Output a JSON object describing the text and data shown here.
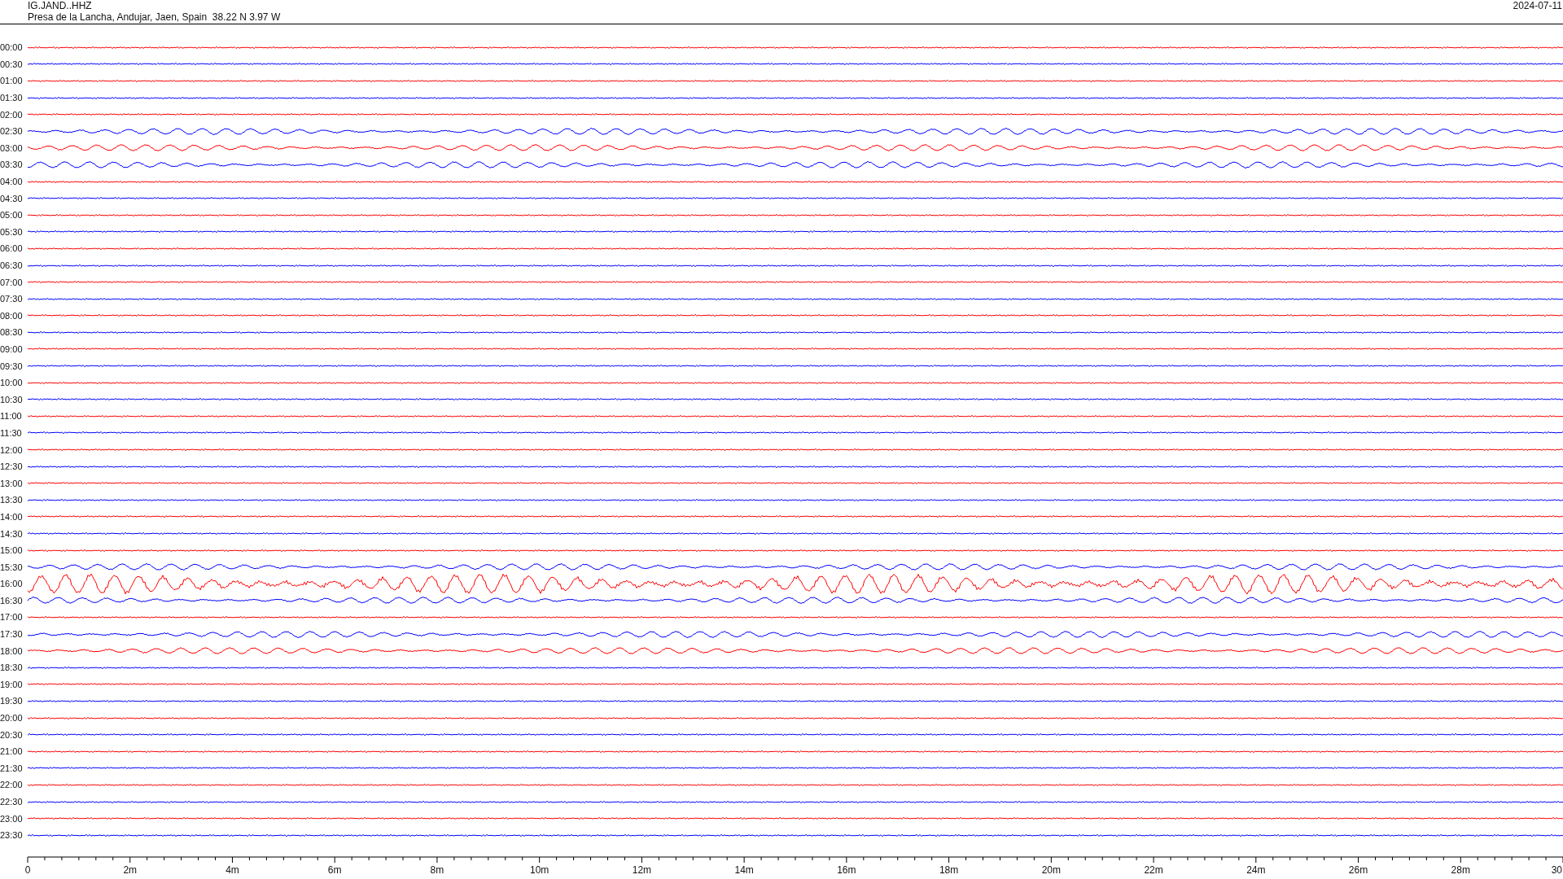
{
  "station": "IG.JAND..HHZ",
  "location": "Presa de la Lancha, Andujar, Jaen, Spain  38.22 N 3.97 W",
  "date": "2024-07-11",
  "rows": [
    {
      "time": "00:00",
      "color": "#ff0000",
      "kind": "quiet"
    },
    {
      "time": "00:30",
      "color": "#0000ff",
      "kind": "quiet"
    },
    {
      "time": "01:00",
      "color": "#ff0000",
      "kind": "quiet"
    },
    {
      "time": "01:30",
      "color": "#0000ff",
      "kind": "quiet"
    },
    {
      "time": "02:00",
      "color": "#ff0000",
      "kind": "quiet"
    },
    {
      "time": "02:30",
      "color": "#0000ff",
      "kind": "active"
    },
    {
      "time": "03:00",
      "color": "#ff0000",
      "kind": "active"
    },
    {
      "time": "03:30",
      "color": "#0000ff",
      "kind": "active"
    },
    {
      "time": "04:00",
      "color": "#ff0000",
      "kind": "quiet"
    },
    {
      "time": "04:30",
      "color": "#0000ff",
      "kind": "quiet"
    },
    {
      "time": "05:00",
      "color": "#ff0000",
      "kind": "quiet"
    },
    {
      "time": "05:30",
      "color": "#0000ff",
      "kind": "quiet"
    },
    {
      "time": "06:00",
      "color": "#ff0000",
      "kind": "quiet"
    },
    {
      "time": "06:30",
      "color": "#0000ff",
      "kind": "quiet"
    },
    {
      "time": "07:00",
      "color": "#ff0000",
      "kind": "quiet"
    },
    {
      "time": "07:30",
      "color": "#0000ff",
      "kind": "quiet"
    },
    {
      "time": "08:00",
      "color": "#ff0000",
      "kind": "quiet"
    },
    {
      "time": "08:30",
      "color": "#0000ff",
      "kind": "quiet"
    },
    {
      "time": "09:00",
      "color": "#ff0000",
      "kind": "quiet"
    },
    {
      "time": "09:30",
      "color": "#0000ff",
      "kind": "quiet"
    },
    {
      "time": "10:00",
      "color": "#ff0000",
      "kind": "quiet"
    },
    {
      "time": "10:30",
      "color": "#0000ff",
      "kind": "quiet"
    },
    {
      "time": "11:00",
      "color": "#ff0000",
      "kind": "quiet"
    },
    {
      "time": "11:30",
      "color": "#0000ff",
      "kind": "quiet"
    },
    {
      "time": "12:00",
      "color": "#ff0000",
      "kind": "quiet"
    },
    {
      "time": "12:30",
      "color": "#0000ff",
      "kind": "quiet"
    },
    {
      "time": "13:00",
      "color": "#ff0000",
      "kind": "quiet"
    },
    {
      "time": "13:30",
      "color": "#0000ff",
      "kind": "quiet"
    },
    {
      "time": "14:00",
      "color": "#ff0000",
      "kind": "quiet"
    },
    {
      "time": "14:30",
      "color": "#0000ff",
      "kind": "quiet"
    },
    {
      "time": "15:00",
      "color": "#ff0000",
      "kind": "quiet"
    },
    {
      "time": "15:30",
      "color": "#0000ff",
      "kind": "active"
    },
    {
      "time": "16:00",
      "color": "#ff0000",
      "kind": "large"
    },
    {
      "time": "16:30",
      "color": "#0000ff",
      "kind": "active"
    },
    {
      "time": "17:00",
      "color": "#ff0000",
      "kind": "quiet"
    },
    {
      "time": "17:30",
      "color": "#0000ff",
      "kind": "active"
    },
    {
      "time": "18:00",
      "color": "#ff0000",
      "kind": "active"
    },
    {
      "time": "18:30",
      "color": "#0000ff",
      "kind": "quiet"
    },
    {
      "time": "19:00",
      "color": "#ff0000",
      "kind": "quiet"
    },
    {
      "time": "19:30",
      "color": "#0000ff",
      "kind": "quiet"
    },
    {
      "time": "20:00",
      "color": "#ff0000",
      "kind": "quiet"
    },
    {
      "time": "20:30",
      "color": "#0000ff",
      "kind": "quiet"
    },
    {
      "time": "21:00",
      "color": "#ff0000",
      "kind": "quiet"
    },
    {
      "time": "21:30",
      "color": "#0000ff",
      "kind": "quiet"
    },
    {
      "time": "22:00",
      "color": "#ff0000",
      "kind": "quiet"
    },
    {
      "time": "22:30",
      "color": "#0000ff",
      "kind": "quiet"
    },
    {
      "time": "23:00",
      "color": "#ff0000",
      "kind": "quiet"
    },
    {
      "time": "23:30",
      "color": "#0000ff",
      "kind": "quiet"
    }
  ],
  "axis_ticks": [
    "0",
    "2m",
    "4m",
    "6m",
    "8m",
    "10m",
    "12m",
    "14m",
    "16m",
    "18m",
    "20m",
    "22m",
    "24m",
    "26m",
    "28m",
    "30"
  ]
}
